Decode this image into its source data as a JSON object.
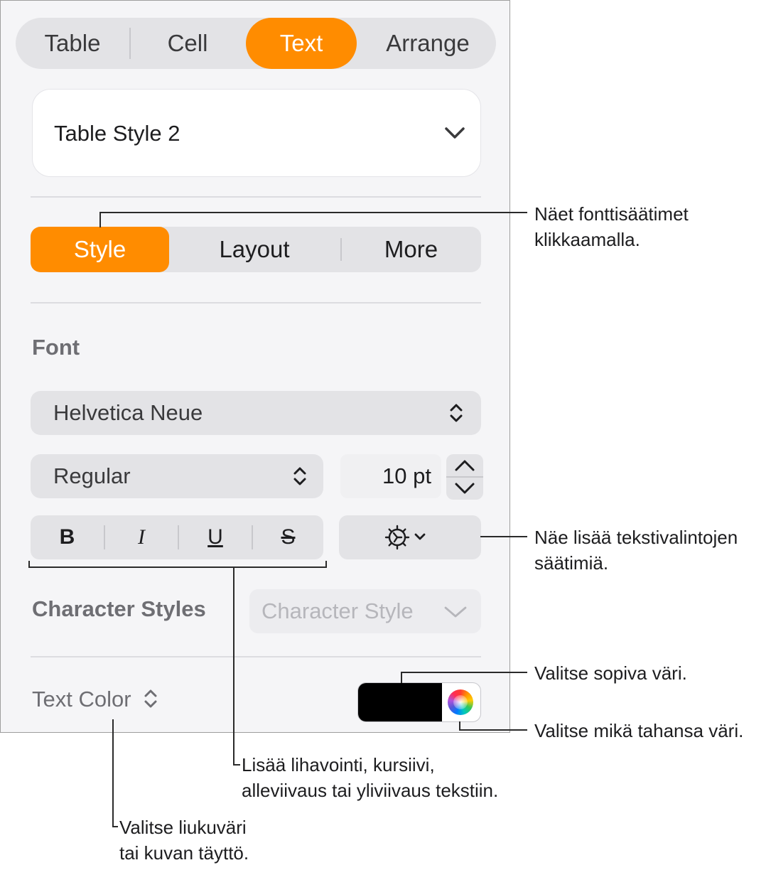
{
  "tabs": [
    {
      "label": "Table"
    },
    {
      "label": "Cell"
    },
    {
      "label": "Text",
      "active": true
    },
    {
      "label": "Arrange"
    }
  ],
  "table_style": {
    "value": "Table Style 2",
    "icon": "chevron-down-icon"
  },
  "subtabs": [
    {
      "label": "Style",
      "active": true
    },
    {
      "label": "Layout"
    },
    {
      "label": "More"
    }
  ],
  "font": {
    "section_title": "Font",
    "family": "Helvetica Neue",
    "typeface": "Regular",
    "size": "10 pt",
    "format_buttons": [
      {
        "label": "B",
        "name": "bold"
      },
      {
        "label": "I",
        "name": "italic"
      },
      {
        "label": "U",
        "name": "underline"
      },
      {
        "label": "S",
        "name": "strikethrough"
      }
    ],
    "advanced_icon": "gear-icon"
  },
  "character_styles": {
    "label": "Character Styles",
    "placeholder": "Character Style"
  },
  "text_color": {
    "label": "Text Color",
    "swatch_color": "#000000",
    "icon": "color-wheel-icon"
  },
  "accent_color": "#ff8c00",
  "callouts": {
    "font_controls": "Näet fonttisäätimet\nklikkaamalla.",
    "more_text_options": "Näe lisää tekstivalintojen\nsäätimiä.",
    "choose_color": "Valitse sopiva väri.",
    "any_color": "Valitse mikä tahansa väri.",
    "text_styles": "Lisää lihavointi, kursiivi,\nalleviivaus tai yliviivaus tekstiin.",
    "gradient_fill": "Valitse liukuväri\ntai kuvan täyttö."
  }
}
